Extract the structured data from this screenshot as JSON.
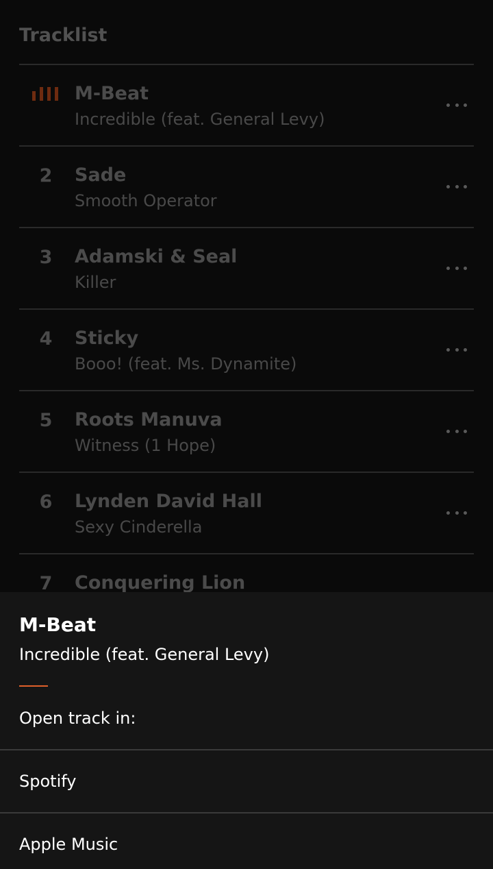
{
  "tracklist": {
    "title": "Tracklist",
    "tracks": [
      {
        "number": "",
        "artist": "M-Beat",
        "title": "Incredible (feat. General Levy)",
        "now_playing": true
      },
      {
        "number": "2",
        "artist": "Sade",
        "title": "Smooth Operator"
      },
      {
        "number": "3",
        "artist": "Adamski & Seal",
        "title": "Killer"
      },
      {
        "number": "4",
        "artist": "Sticky",
        "title": "Booo! (feat. Ms. Dynamite)"
      },
      {
        "number": "5",
        "artist": "Roots Manuva",
        "title": "Witness (1 Hope)"
      },
      {
        "number": "6",
        "artist": "Lynden David Hall",
        "title": "Sexy Cinderella"
      },
      {
        "number": "7",
        "artist": "Conquering Lion",
        "title": ""
      }
    ]
  },
  "sheet": {
    "artist": "M-Beat",
    "title": "Incredible (feat. General Levy)",
    "prompt": "Open track in:",
    "options": [
      "Spotify",
      "Apple Music"
    ]
  },
  "colors": {
    "accent": "#e0602a",
    "now_playing_icon": "#6e2b10",
    "background": "#0a0a0a",
    "sheet_background": "#151515"
  },
  "icons": {
    "now_playing": "equalizer-icon",
    "more": "more-horizontal-icon"
  }
}
